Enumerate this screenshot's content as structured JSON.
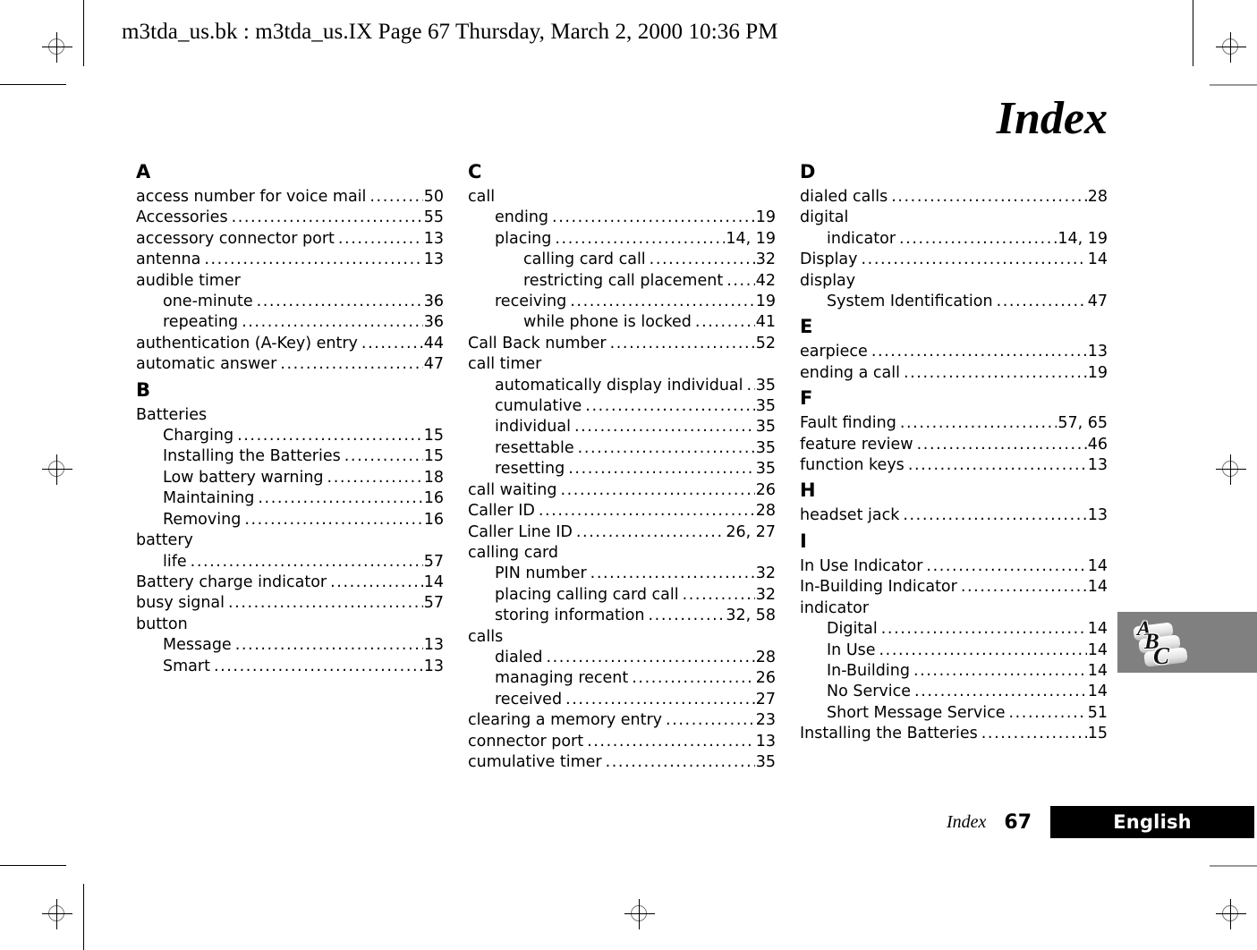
{
  "header": {
    "file_line": "m3tda_us.bk : m3tda_us.IX  Page 67  Thursday, March 2, 2000  10:36 PM"
  },
  "title": "Index",
  "thumb_tab": {
    "letters": [
      "A",
      "B",
      "C"
    ],
    "background_color": "#808080"
  },
  "footer": {
    "section": "Index",
    "page_number": "67",
    "language": "English",
    "language_bg": "#000000",
    "language_fg": "#ffffff"
  },
  "leader_dots": "..................................................................................................",
  "columns": [
    {
      "sections": [
        {
          "letter": "A",
          "entries": [
            {
              "level": 1,
              "label": "access number for voice mail",
              "page": "50"
            },
            {
              "level": 1,
              "label": "Accessories",
              "page": "55"
            },
            {
              "level": 1,
              "label": "accessory connector port",
              "page": "13"
            },
            {
              "level": 1,
              "label": "antenna",
              "page": "13"
            },
            {
              "level": 1,
              "label": "audible timer",
              "page": ""
            },
            {
              "level": 2,
              "label": "one-minute",
              "page": "36"
            },
            {
              "level": 2,
              "label": "repeating",
              "page": "36"
            },
            {
              "level": 1,
              "label": "authentication (A-Key) entry",
              "page": "44"
            },
            {
              "level": 1,
              "label": "automatic answer",
              "page": "47"
            }
          ]
        },
        {
          "letter": "B",
          "entries": [
            {
              "level": 1,
              "label": "Batteries",
              "page": ""
            },
            {
              "level": 2,
              "label": "Charging",
              "page": "15"
            },
            {
              "level": 2,
              "label": "Installing the Batteries",
              "page": "15"
            },
            {
              "level": 2,
              "label": "Low battery warning",
              "page": "18"
            },
            {
              "level": 2,
              "label": "Maintaining",
              "page": "16"
            },
            {
              "level": 2,
              "label": "Removing",
              "page": "16"
            },
            {
              "level": 1,
              "label": "battery",
              "page": ""
            },
            {
              "level": 2,
              "label": "life",
              "page": "57"
            },
            {
              "level": 1,
              "label": "Battery charge indicator",
              "page": "14"
            },
            {
              "level": 1,
              "label": "busy signal",
              "page": "57"
            },
            {
              "level": 1,
              "label": "button",
              "page": ""
            },
            {
              "level": 2,
              "label": "Message",
              "page": "13"
            },
            {
              "level": 2,
              "label": "Smart",
              "page": "13"
            }
          ]
        }
      ]
    },
    {
      "sections": [
        {
          "letter": "C",
          "entries": [
            {
              "level": 1,
              "label": "call",
              "page": ""
            },
            {
              "level": 2,
              "label": "ending",
              "page": "19"
            },
            {
              "level": 2,
              "label": "placing",
              "page": "14, 19"
            },
            {
              "level": 3,
              "label": "calling card call",
              "page": "32"
            },
            {
              "level": 3,
              "label": "restricting call placement",
              "page": "42"
            },
            {
              "level": 2,
              "label": "receiving",
              "page": "19"
            },
            {
              "level": 3,
              "label": "while phone is locked",
              "page": "41"
            },
            {
              "level": 1,
              "label": "Call Back number",
              "page": "52"
            },
            {
              "level": 1,
              "label": "call timer",
              "page": ""
            },
            {
              "level": 2,
              "label": "automatically display individual",
              "page": "35"
            },
            {
              "level": 2,
              "label": "cumulative",
              "page": "35"
            },
            {
              "level": 2,
              "label": "individual",
              "page": "35"
            },
            {
              "level": 2,
              "label": "resettable",
              "page": "35"
            },
            {
              "level": 2,
              "label": "resetting",
              "page": "35"
            },
            {
              "level": 1,
              "label": "call waiting",
              "page": "26"
            },
            {
              "level": 1,
              "label": "Caller ID",
              "page": "28"
            },
            {
              "level": 1,
              "label": "Caller Line ID",
              "page": "26, 27"
            },
            {
              "level": 1,
              "label": "calling card",
              "page": ""
            },
            {
              "level": 2,
              "label": "PIN number",
              "page": "32"
            },
            {
              "level": 2,
              "label": "placing calling card call",
              "page": "32"
            },
            {
              "level": 2,
              "label": "storing information",
              "page": "32, 58"
            },
            {
              "level": 1,
              "label": "calls",
              "page": ""
            },
            {
              "level": 2,
              "label": "dialed",
              "page": "28"
            },
            {
              "level": 2,
              "label": "managing recent",
              "page": "26"
            },
            {
              "level": 2,
              "label": "received",
              "page": "27"
            },
            {
              "level": 1,
              "label": "clearing a memory entry",
              "page": "23"
            },
            {
              "level": 1,
              "label": "connector port",
              "page": "13"
            },
            {
              "level": 1,
              "label": "cumulative timer",
              "page": "35"
            }
          ]
        }
      ]
    },
    {
      "sections": [
        {
          "letter": "D",
          "entries": [
            {
              "level": 1,
              "label": "dialed calls",
              "page": "28"
            },
            {
              "level": 1,
              "label": "digital",
              "page": ""
            },
            {
              "level": 2,
              "label": "indicator",
              "page": "14, 19"
            },
            {
              "level": 1,
              "label": "Display",
              "page": "14"
            },
            {
              "level": 1,
              "label": "display",
              "page": ""
            },
            {
              "level": 2,
              "label": "System Identification",
              "page": "47"
            }
          ]
        },
        {
          "letter": "E",
          "entries": [
            {
              "level": 1,
              "label": "earpiece",
              "page": "13"
            },
            {
              "level": 1,
              "label": "ending a call",
              "page": "19"
            }
          ]
        },
        {
          "letter": "F",
          "entries": [
            {
              "level": 1,
              "label": "Fault finding",
              "page": "57, 65"
            },
            {
              "level": 1,
              "label": "feature review",
              "page": "46"
            },
            {
              "level": 1,
              "label": "function keys",
              "page": "13"
            }
          ]
        },
        {
          "letter": "H",
          "entries": [
            {
              "level": 1,
              "label": "headset jack",
              "page": "13"
            }
          ]
        },
        {
          "letter": "I",
          "entries": [
            {
              "level": 1,
              "label": "In Use Indicator",
              "page": "14"
            },
            {
              "level": 1,
              "label": "In-Building Indicator",
              "page": "14"
            },
            {
              "level": 1,
              "label": "indicator",
              "page": ""
            },
            {
              "level": 2,
              "label": "Digital",
              "page": "14"
            },
            {
              "level": 2,
              "label": "In Use",
              "page": "14"
            },
            {
              "level": 2,
              "label": "In-Building",
              "page": "14"
            },
            {
              "level": 2,
              "label": "No Service",
              "page": "14"
            },
            {
              "level": 2,
              "label": "Short Message Service",
              "page": "51"
            },
            {
              "level": 1,
              "label": "Installing the Batteries",
              "page": "15"
            }
          ]
        }
      ]
    }
  ]
}
